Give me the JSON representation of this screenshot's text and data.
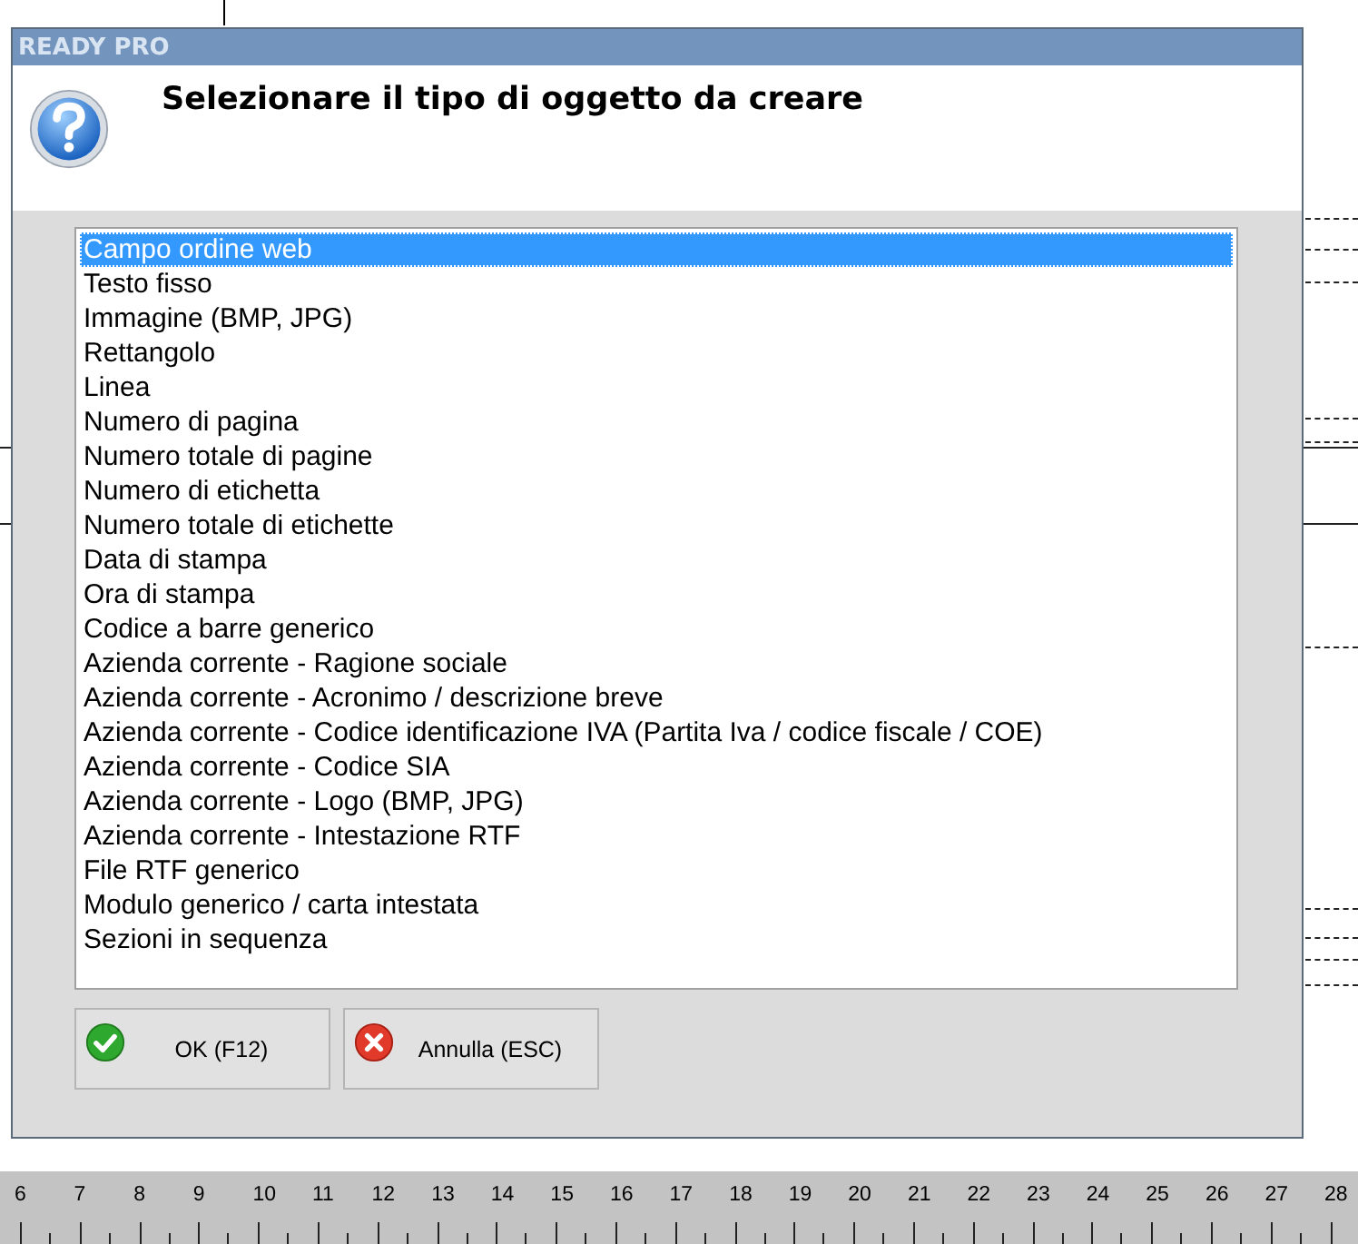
{
  "window": {
    "title": "READY PRO"
  },
  "header": {
    "message": "Selezionare il tipo di oggetto da creare"
  },
  "list": {
    "items": [
      {
        "label": "Campo ordine web",
        "selected": true
      },
      {
        "label": "Testo fisso",
        "selected": false
      },
      {
        "label": "Immagine (BMP, JPG)",
        "selected": false
      },
      {
        "label": "Rettangolo",
        "selected": false
      },
      {
        "label": "Linea",
        "selected": false
      },
      {
        "label": "Numero di pagina",
        "selected": false
      },
      {
        "label": "Numero totale di pagine",
        "selected": false
      },
      {
        "label": "Numero di etichetta",
        "selected": false
      },
      {
        "label": "Numero totale di etichette",
        "selected": false
      },
      {
        "label": "Data di stampa",
        "selected": false
      },
      {
        "label": "Ora di stampa",
        "selected": false
      },
      {
        "label": "Codice a barre generico",
        "selected": false
      },
      {
        "label": "Azienda corrente - Ragione sociale",
        "selected": false
      },
      {
        "label": "Azienda corrente - Acronimo / descrizione breve",
        "selected": false
      },
      {
        "label": "Azienda corrente - Codice identificazione IVA (Partita Iva / codice fiscale / COE)",
        "selected": false
      },
      {
        "label": "Azienda corrente - Codice SIA",
        "selected": false
      },
      {
        "label": "Azienda corrente - Logo (BMP, JPG)",
        "selected": false
      },
      {
        "label": "Azienda corrente - Intestazione RTF",
        "selected": false
      },
      {
        "label": "File RTF generico",
        "selected": false
      },
      {
        "label": "Modulo generico / carta intestata",
        "selected": false
      },
      {
        "label": "Sezioni in sequenza",
        "selected": false
      }
    ]
  },
  "buttons": [
    {
      "label": "OK (F12)",
      "kind": "ok"
    },
    {
      "label": "Annulla (ESC)",
      "kind": "cancel"
    }
  ],
  "ruler": {
    "labels": [
      "6",
      "7",
      "8",
      "9",
      "10",
      "11",
      "12",
      "13",
      "14",
      "15",
      "16",
      "17",
      "18",
      "19",
      "20",
      "21",
      "22",
      "23",
      "24",
      "25",
      "26",
      "27",
      "28"
    ]
  }
}
